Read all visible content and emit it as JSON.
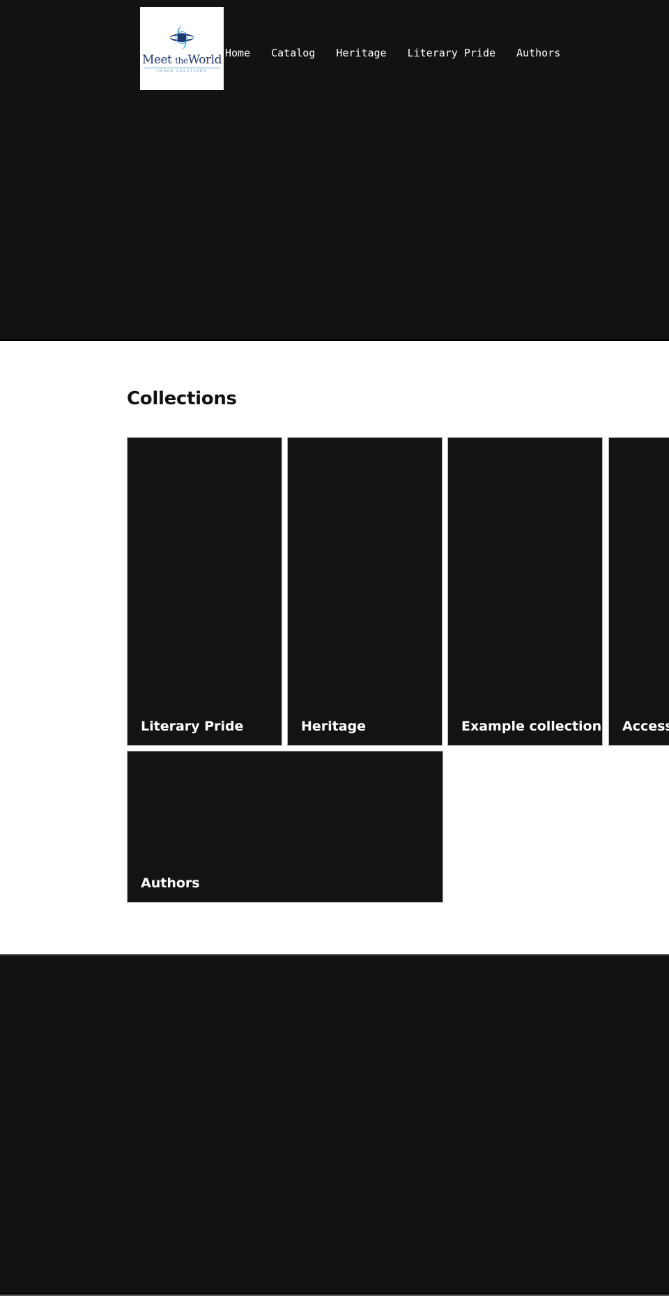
{
  "header": {
    "logo": {
      "title_part1": "Meet",
      "title_part2": "the",
      "title_part3": "World",
      "subtitle": "IMAGE SOLUTIONS",
      "colors": {
        "navy": "#1f3a70",
        "teal": "#4ab0dc"
      }
    },
    "nav": [
      {
        "label": "Home"
      },
      {
        "label": "Catalog"
      },
      {
        "label": "Heritage"
      },
      {
        "label": "Literary Pride"
      },
      {
        "label": "Authors"
      }
    ]
  },
  "collections": {
    "title": "Collections",
    "items": [
      {
        "label": "Literary Pride"
      },
      {
        "label": "Heritage"
      },
      {
        "label": "Example collection"
      },
      {
        "label": "Accessibility"
      },
      {
        "label": "Authors"
      }
    ]
  },
  "colors": {
    "dark_band": "#121212",
    "card_bg": "#131313",
    "page_bg": "#ffffff",
    "text_on_dark": "#ffffff",
    "heading": "#111111"
  }
}
